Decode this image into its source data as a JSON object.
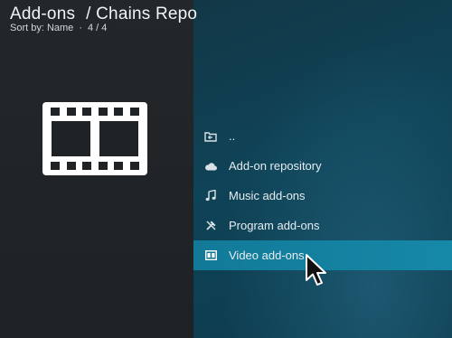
{
  "header": {
    "title": "Add-ons",
    "path": "/ Chains Repo",
    "sort_label": "Sort by: Name",
    "separator": "·",
    "count": "4 / 4"
  },
  "list": {
    "items": [
      {
        "label": "..",
        "icon": "folder-back-icon",
        "selected": false
      },
      {
        "label": "Add-on repository",
        "icon": "cloud-icon",
        "selected": false
      },
      {
        "label": "Music add-ons",
        "icon": "music-note-icon",
        "selected": false
      },
      {
        "label": "Program add-ons",
        "icon": "tools-icon",
        "selected": false
      },
      {
        "label": "Video add-ons",
        "icon": "video-icon",
        "selected": true
      }
    ]
  },
  "thumbnail": {
    "icon": "film-strip-icon"
  },
  "colors": {
    "left_bg": "#23272a",
    "right_bg": "#0f4357",
    "selected_bg": "#14809f",
    "text": "#e6edf0"
  }
}
